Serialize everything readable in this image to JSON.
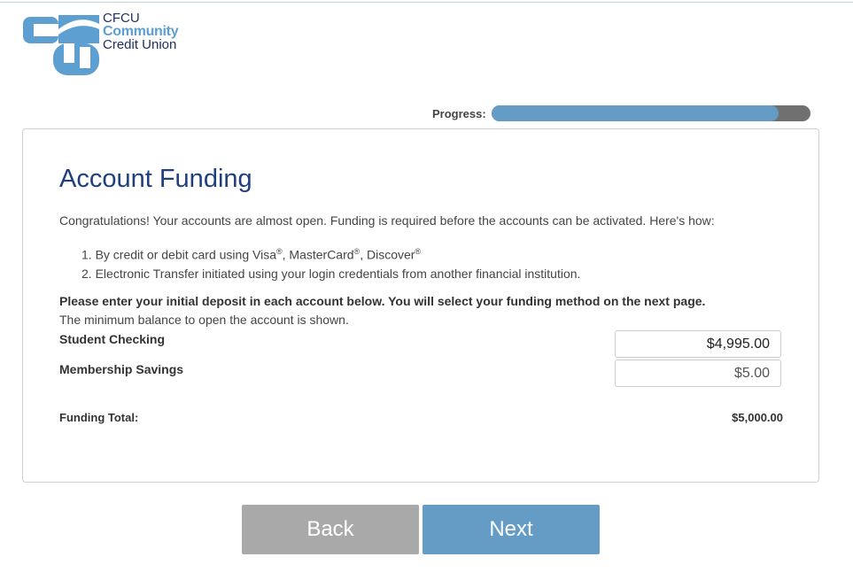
{
  "logo": {
    "line1": "CFCU",
    "line2": "Community",
    "line3": "Credit Union"
  },
  "progress": {
    "label": "Progress:",
    "fraction": 0.9
  },
  "page": {
    "title": "Account Funding",
    "intro": "Congratulations! Your accounts are almost open. Funding is required before the accounts can be activated. Here's how:",
    "steps": [
      {
        "num": "1.",
        "text_before": "By credit or debit card using Visa",
        "text_mid1": ", MasterCard",
        "text_mid2": ", Discover",
        "reg": "®"
      },
      {
        "num": "2.",
        "text": "Electronic Transfer initiated using your login credentials from another financial institution."
      }
    ],
    "instruction": "Please enter your initial deposit in each account below. You will select your funding method on the next page.",
    "min_balance_note": "The minimum balance to open the account is shown."
  },
  "accounts": [
    {
      "label": "Student Checking",
      "value": "$4,995.00"
    },
    {
      "label": "Membership Savings",
      "value": "$5.00"
    }
  ],
  "total": {
    "label": "Funding Total:",
    "value": "$5,000.00"
  },
  "buttons": {
    "back": "Back",
    "next": "Next"
  },
  "colors": {
    "brand_dark": "#1e2f5e",
    "brand_light": "#5e9fd1",
    "accent": "#649cc5",
    "back_button": "#a9a9a9"
  }
}
